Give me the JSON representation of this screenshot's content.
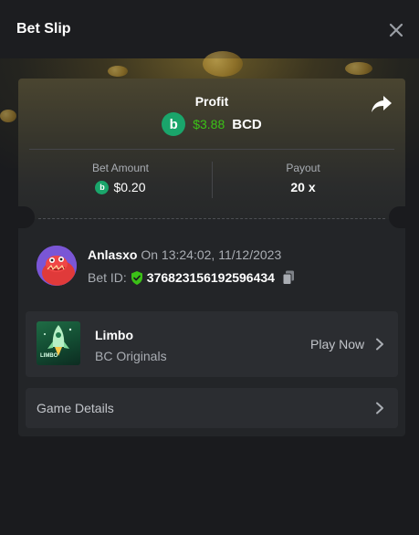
{
  "header": {
    "title": "Bet Slip"
  },
  "profit": {
    "label": "Profit",
    "value": "$3.88",
    "currency": "BCD"
  },
  "coin_symbol": "b",
  "stats": {
    "bet_amount_label": "Bet Amount",
    "bet_amount_value": "$0.20",
    "payout_label": "Payout",
    "payout_value": "20 x"
  },
  "bet": {
    "username": "Anlasxo",
    "time_text": "On 13:24:02, 11/12/2023",
    "bet_id_label": "Bet ID:",
    "bet_id": "376823156192596434"
  },
  "game": {
    "name": "Limbo",
    "provider": "BC Originals",
    "thumb_caption": "LIMBO",
    "play_label": "Play Now"
  },
  "details": {
    "label": "Game Details"
  },
  "colors": {
    "profit_green": "#3bc117",
    "coin_green": "#1aa56b",
    "verified_green": "#3bc117"
  },
  "icons": [
    "close-icon",
    "share-icon",
    "bcd-coin-icon",
    "verified-shield-icon",
    "copy-icon",
    "rocket-icon",
    "chevron-right-icon"
  ]
}
